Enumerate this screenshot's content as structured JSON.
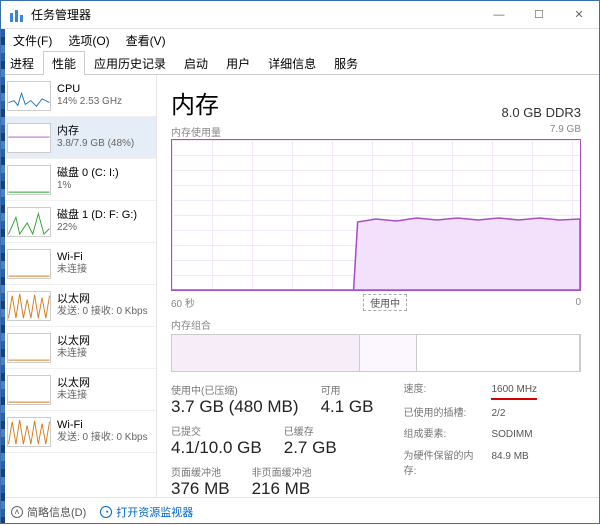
{
  "window": {
    "title": "任务管理器",
    "min": "—",
    "max": "☐",
    "close": "✕"
  },
  "menubar": [
    "文件(F)",
    "选项(O)",
    "查看(V)"
  ],
  "tabs": [
    "进程",
    "性能",
    "应用历史记录",
    "启动",
    "用户",
    "详细信息",
    "服务"
  ],
  "active_tab": 1,
  "sidebar": [
    {
      "name": "CPU",
      "sub": "14% 2.53 GHz",
      "color": "#1f77b4",
      "type": "cpu"
    },
    {
      "name": "内存",
      "sub": "3.8/7.9 GB (48%)",
      "color": "#a74fc7",
      "type": "mem",
      "selected": true
    },
    {
      "name": "磁盘 0 (C: I:)",
      "sub": "1%",
      "color": "#2ca02c",
      "type": "disk"
    },
    {
      "name": "磁盘 1 (D: F: G:)",
      "sub": "22%",
      "color": "#2ca02c",
      "type": "disk2"
    },
    {
      "name": "Wi-Fi",
      "sub": "未连接",
      "color": "#d67b1f",
      "type": "flat"
    },
    {
      "name": "以太网",
      "sub": "发送: 0 接收: 0 Kbps",
      "color": "#d67b1f",
      "type": "eth"
    },
    {
      "name": "以太网",
      "sub": "未连接",
      "color": "#d67b1f",
      "type": "flat"
    },
    {
      "name": "以太网",
      "sub": "未连接",
      "color": "#d67b1f",
      "type": "flat"
    },
    {
      "name": "Wi-Fi",
      "sub": "发送: 0 接收: 0 Kbps",
      "color": "#d67b1f",
      "type": "eth"
    }
  ],
  "main": {
    "title": "内存",
    "spec": "8.0 GB DDR3",
    "usage_label": "内存使用量",
    "scale_top": "7.9 GB",
    "time_left": "60 秒",
    "time_right": "0",
    "in_use_box": "使用中",
    "composition_label": "内存组合"
  },
  "stats": {
    "row1": [
      {
        "label": "使用中(已压缩)",
        "value": "3.7 GB (480 MB)"
      },
      {
        "label": "可用",
        "value": "4.1 GB"
      }
    ],
    "row2": [
      {
        "label": "已提交",
        "value": "4.1/10.0 GB"
      },
      {
        "label": "已缓存",
        "value": "2.7 GB"
      }
    ],
    "row3": [
      {
        "label": "页面缓冲池",
        "value": "376 MB"
      },
      {
        "label": "非页面缓冲池",
        "value": "216 MB"
      }
    ]
  },
  "kv": [
    {
      "k": "速度:",
      "v": "1600 MHz",
      "hl": true
    },
    {
      "k": "已使用的插槽:",
      "v": "2/2"
    },
    {
      "k": "组成要素:",
      "v": "SODIMM"
    },
    {
      "k": "为硬件保留的内存:",
      "v": "84.9 MB"
    }
  ],
  "footer": {
    "fewer": "简略信息(D)",
    "resmon": "打开资源监视器"
  },
  "chart_data": {
    "type": "area",
    "title": "内存使用量",
    "xlabel": "60 秒 → 0",
    "ylabel": "GB",
    "ylim": [
      0,
      7.9
    ],
    "x": [
      60,
      58,
      56,
      54,
      52,
      50,
      48,
      46,
      44,
      42,
      40,
      38,
      36,
      34,
      32,
      30,
      28,
      26,
      24,
      22,
      20,
      18,
      16,
      14,
      12,
      10,
      8,
      6,
      4,
      2,
      0
    ],
    "values": [
      0,
      0,
      0,
      0,
      0,
      0,
      0,
      0,
      0,
      0,
      0,
      0,
      0,
      0,
      3.7,
      3.8,
      3.75,
      3.8,
      3.78,
      3.8,
      3.75,
      3.8,
      3.78,
      3.8,
      3.76,
      3.8,
      3.77,
      3.8,
      3.78,
      3.8,
      3.78
    ]
  }
}
